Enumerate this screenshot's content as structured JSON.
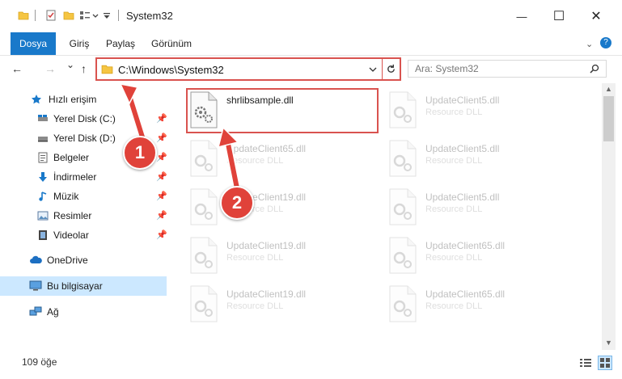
{
  "window": {
    "title": "System32",
    "minimize_glyph": "—",
    "maximize_glyph": "☐",
    "close_glyph": "✕"
  },
  "ribbon": {
    "tabs": [
      {
        "label": "Dosya"
      },
      {
        "label": "Giriş"
      },
      {
        "label": "Paylaş"
      },
      {
        "label": "Görünüm"
      }
    ],
    "help_glyph": "?"
  },
  "nav": {
    "back_glyph": "←",
    "forward_glyph": "→",
    "recent_glyph": "⌄",
    "up_glyph": "↑",
    "address": "C:\\Windows\\System32",
    "search_placeholder": "Ara: System32"
  },
  "sidebar": {
    "quick_access": "Hızlı erişim",
    "items": [
      {
        "label": "Yerel Disk (C:)"
      },
      {
        "label": "Yerel Disk (D:)"
      },
      {
        "label": "Belgeler"
      },
      {
        "label": "İndirmeler"
      },
      {
        "label": "Müzik"
      },
      {
        "label": "Resimler"
      },
      {
        "label": "Videolar"
      }
    ],
    "onedrive": "OneDrive",
    "this_pc": "Bu bilgisayar",
    "network": "Ağ"
  },
  "files": [
    {
      "name": "shrlibsample.dll",
      "type": ""
    },
    {
      "name": "UpdateClient5.dll",
      "type": "Resource DLL"
    },
    {
      "name": "UpdateClient65.dll",
      "type": "Resource DLL"
    },
    {
      "name": "UpdateClient5.dll",
      "type": "Resource DLL"
    },
    {
      "name": "UpdateClient19.dll",
      "type": "Resource DLL"
    },
    {
      "name": "UpdateClient5.dll",
      "type": "Resource DLL"
    },
    {
      "name": "UpdateClient19.dll",
      "type": "Resource DLL"
    },
    {
      "name": "UpdateClient65.dll",
      "type": "Resource DLL"
    },
    {
      "name": "UpdateClient19.dll",
      "type": "Resource DLL"
    },
    {
      "name": "UpdateClient65.dll",
      "type": "Resource DLL"
    }
  ],
  "status": {
    "count": "109 öğe"
  },
  "callouts": {
    "one": "1",
    "two": "2"
  },
  "colors": {
    "accent": "#1979ca",
    "highlight": "#d9534f",
    "callout": "#e0423a",
    "selected": "#cce8ff"
  }
}
